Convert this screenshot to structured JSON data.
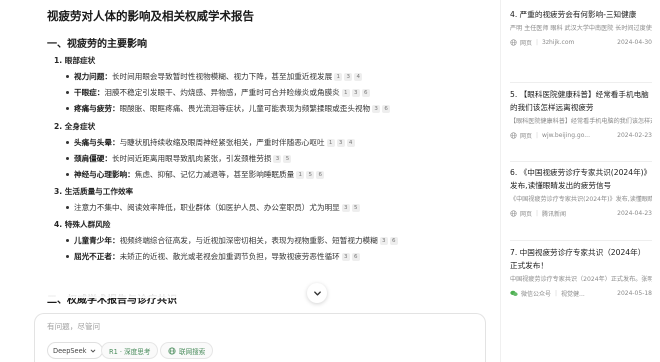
{
  "doc": {
    "title": "视疲劳对人体的影响及相关权威学术报告",
    "section1_title": "一、视疲劳的主要影响",
    "section2_title": "二、权威学术报告与诊疗共识",
    "groups": [
      {
        "label": "1. 眼部症状",
        "items": [
          {
            "bold": "视力问题：",
            "text": "长时间用眼会导致暂时性视物模糊、视力下降，甚至加重近视发展",
            "cites": [
              "1",
              "3",
              "4"
            ]
          },
          {
            "bold": "干眼症：",
            "text": "泪膜不稳定引发眼干、灼烧感、异物感，严重时可合并睑缘炎或角膜炎",
            "cites": [
              "1",
              "3",
              "6"
            ]
          },
          {
            "bold": "疼痛与疲劳：",
            "text": "眼酸胀、眼眶疼痛、畏光流泪等症状，儿童可能表现为频繁揉眼或歪头视物",
            "cites": [
              "3",
              "6"
            ]
          }
        ]
      },
      {
        "label": "2. 全身症状",
        "items": [
          {
            "bold": "头痛与头晕：",
            "text": "与睫状肌持续收缩及眼周神经紧张相关，严重时伴随恶心呕吐",
            "cites": [
              "1",
              "3",
              "4"
            ]
          },
          {
            "bold": "颈肩僵硬：",
            "text": "长时间近距离用眼导致肌肉紧张，引发颈椎劳损",
            "cites": [
              "3",
              "5"
            ]
          },
          {
            "bold": "神经与心理影响：",
            "text": "焦虑、抑郁、记忆力减退等，甚至影响睡眠质量",
            "cites": [
              "1",
              "5",
              "6"
            ]
          }
        ]
      },
      {
        "label": "3. 生活质量与工作效率",
        "items": [
          {
            "bold": "",
            "text": "注意力不集中、阅读效率降低，职业群体（如医护人员、办公室职员）尤为明显",
            "cites": [
              "3",
              "5"
            ]
          }
        ]
      },
      {
        "label": "4. 特殊人群风险",
        "items": [
          {
            "bold": "儿童青少年：",
            "text": "视频终端综合征高发，与近视加深密切相关，表现为视物重影、短暂视力模糊",
            "cites": [
              "3",
              "6"
            ]
          },
          {
            "bold": "屈光不正者：",
            "text": "未矫正的近视、散光或老视会加重调节负担，导致视疲劳恶性循环",
            "cites": [
              "3",
              "6"
            ]
          }
        ]
      }
    ]
  },
  "input": {
    "placeholder": "有问题，尽管问",
    "model_label": "DeepSeek",
    "deep_think_label": "R1 · 深度思考",
    "web_search_label": "联网搜索"
  },
  "sources": [
    {
      "title": "4. 严重的视疲劳会有何影响-三知健康",
      "snippet": "严明 主任医师 眼科 武汉大学中南医院 长时间过度使用眼睛可能会导致视疲劳 给人...",
      "site_type": "网页",
      "site": "3zhijk.com",
      "date": "2024-04-30"
    },
    {
      "title": "5. 【眼科医院健康科普】经常看手机电脑的我们该怎样远离视疲劳",
      "snippet": "【眼科医院健康科普】经常看手机电脑的我们该怎样远离视疲劳 发布日期2024-0...",
      "site_type": "网页",
      "site": "wjw.beijing.go...",
      "date": "2024-02-23"
    },
    {
      "title": "6. 《中国视疲劳诊疗专家共识(2024年)》发布,读懂眼睛发出的疲劳信号",
      "snippet": "《中国视疲劳诊疗专家共识(2024年)》发布,读懂眼睛发出的疲劳信号 2024-04-23...",
      "site_type": "网页",
      "site": "腾讯新闻",
      "date": "2024-04-23"
    },
    {
      "title": "7. 中国视疲劳诊疗专家共识（2024年）正式发布！",
      "snippet": "中国视疲劳诊疗专家共识（2024年）正式发布。张明昌 许梅萍 vision china 2024 ...",
      "site_type": "微信公众号",
      "site": "视觉健...",
      "date": "2024-05-18"
    }
  ],
  "colors": {
    "accent_green": "#4a8c5c",
    "cite_bg": "#eeeeee",
    "muted_text": "#8a8a8a"
  },
  "icons": {
    "scroll_down": "chevron-down-icon",
    "model": "deepseek-logo-icon",
    "deep_think": "atom-icon",
    "web_search": "globe-icon",
    "site_web": "globe-icon",
    "site_wechat": "wechat-icon"
  }
}
